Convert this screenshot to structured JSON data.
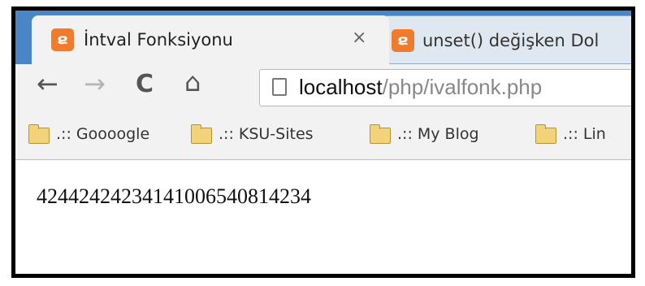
{
  "tabs": [
    {
      "title": "İntval Fonksiyonu",
      "close": "×",
      "favicon": "xampp-icon"
    },
    {
      "title": "unset() değişken Dol",
      "favicon": "xampp-icon"
    }
  ],
  "toolbar": {
    "back": "←",
    "forward": "→",
    "reload": "C",
    "home": "⌂",
    "url_host": "localhost",
    "url_path": "/php/ivalfonk.php"
  },
  "bookmarks": [
    {
      "label": ".:: Goooogle"
    },
    {
      "label": ".:: KSU-Sites"
    },
    {
      "label": ".:: My Blog"
    },
    {
      "label": ".:: Lin"
    }
  ],
  "page": {
    "text": "42442424234141006540814234"
  },
  "colors": {
    "tabstrip": "#4a86c6",
    "favicon": "#f07b2c",
    "folder": "#f2d27a"
  }
}
